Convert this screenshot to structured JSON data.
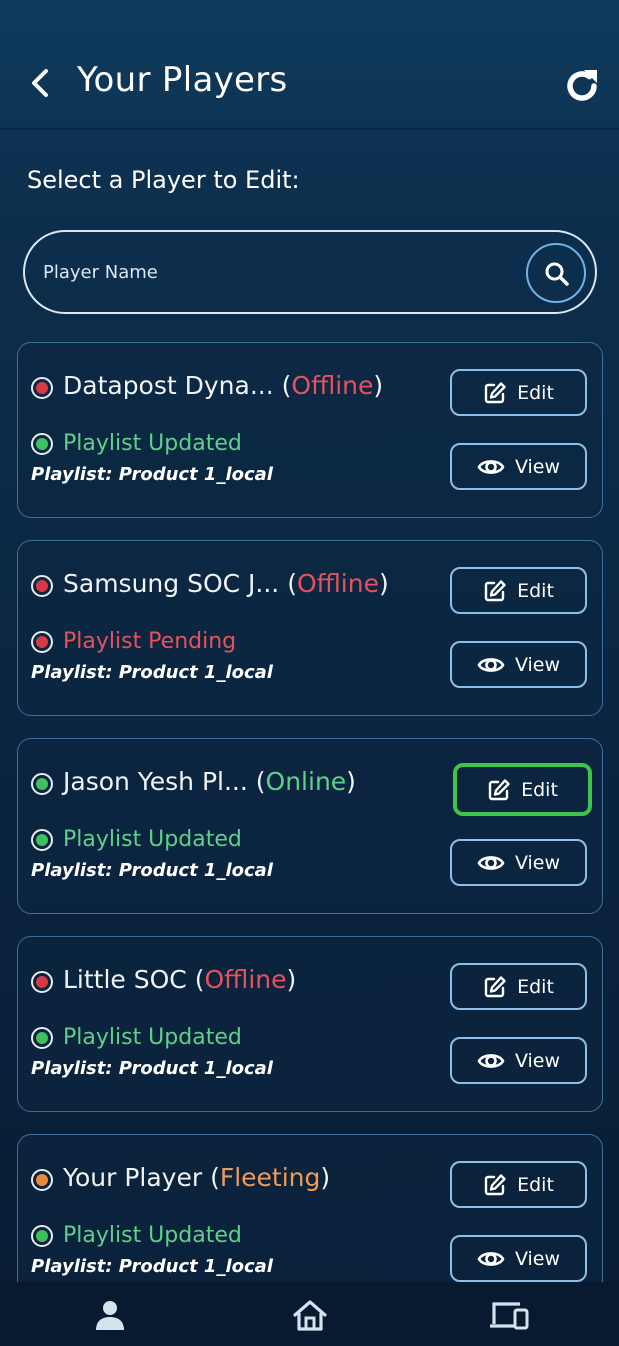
{
  "header": {
    "title": "Your Players"
  },
  "subtitle": "Select a Player to Edit:",
  "search": {
    "placeholder": "Player Name"
  },
  "players": [
    {
      "name": "Datapost Dyna...",
      "status": "Offline",
      "status_color": "#e6525c",
      "playlist_status": "Playlist Updated",
      "playlist_color": "#5fd08a",
      "dot_color": "#d83a45",
      "playlist_dot_color": "#3fbf5d",
      "playlist_label": "Playlist: Product 1_local"
    },
    {
      "name": "Samsung SOC J...",
      "status": "Offline",
      "status_color": "#e6525c",
      "playlist_status": "Playlist Pending",
      "playlist_color": "#e6525c",
      "dot_color": "#d83a45",
      "playlist_dot_color": "#d83a45",
      "playlist_label": "Playlist: Product 1_local"
    },
    {
      "name": "Jason Yesh Pl...",
      "status": "Online",
      "status_color": "#5fd08a",
      "playlist_status": "Playlist Updated",
      "playlist_color": "#5fd08a",
      "dot_color": "#3fbf5d",
      "playlist_dot_color": "#3fbf5d",
      "playlist_label": "Playlist: Product 1_local"
    },
    {
      "name": "Little SOC",
      "status": "Offline",
      "status_color": "#e6525c",
      "playlist_status": "Playlist Updated",
      "playlist_color": "#5fd08a",
      "dot_color": "#d83a45",
      "playlist_dot_color": "#3fbf5d",
      "playlist_label": "Playlist: Product 1_local"
    },
    {
      "name": "Your Player",
      "status": "Fleeting",
      "status_color": "#f09a5a",
      "playlist_status": "Playlist Updated",
      "playlist_color": "#5fd08a",
      "dot_color": "#ea8a3a",
      "playlist_dot_color": "#3fbf5d",
      "playlist_label": "Playlist: Product 1_local"
    }
  ],
  "buttons": {
    "edit_label": "Edit",
    "view_label": "View"
  },
  "highlight_color": "#3fc34a",
  "nav": {
    "items": [
      "profile-icon",
      "home-icon",
      "devices-icon"
    ]
  }
}
